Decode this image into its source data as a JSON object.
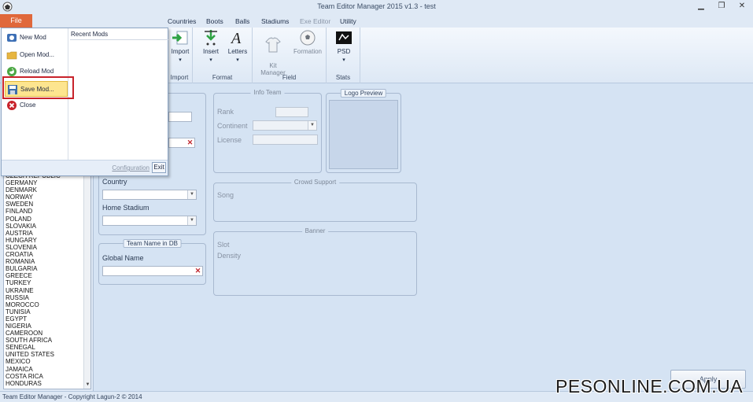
{
  "window": {
    "title": "Team Editor Manager 2015 v1.3 - test",
    "controls": {
      "minimize": "▁",
      "restore": "❐",
      "close": "✕"
    }
  },
  "menubar": {
    "file": "File",
    "items": [
      "Countries",
      "Boots",
      "Balls",
      "Stadiums",
      "Exe Editor",
      "Utility"
    ]
  },
  "ribbon": {
    "import": {
      "label": "Import",
      "group": "Import"
    },
    "insert": "Insert",
    "letters": "Letters",
    "format_group": "Format",
    "kit_manager": "Kit\nManager",
    "formation": "Formation",
    "field_group": "Field",
    "psd": "PSD",
    "stats_group": "Stats"
  },
  "file_menu": {
    "items": [
      {
        "label": "New Mod",
        "icon": "new-mod-icon"
      },
      {
        "label": "Open Mod...",
        "icon": "folder-icon"
      },
      {
        "label": "Reload Mod",
        "icon": "reload-icon"
      },
      {
        "label": "Save Mod...",
        "icon": "save-icon",
        "highlighted": true
      },
      {
        "label": "Close",
        "icon": "close-icon"
      }
    ],
    "recent_title": "Recent Mods",
    "configuration": "Configuration",
    "exit": "Exit"
  },
  "form": {
    "country_label": "Country",
    "home_stadium_label": "Home Stadium",
    "team_name_db_title": "Team Name in DB",
    "global_name_label": "Global Name",
    "info_team_title": "Info Team",
    "rank_label": "Rank",
    "continent_label": "Continent",
    "license_label": "License",
    "logo_preview_title": "Logo Preview",
    "crowd_support_title": "Crowd Support",
    "song_label": "Song",
    "banner_title": "Banner",
    "slot_label": "Slot",
    "density_label": "Density",
    "apply": "Apply"
  },
  "team_list": [
    "CZECH REPUBLIC",
    "GERMANY",
    "DENMARK",
    "NORWAY",
    "SWEDEN",
    "FINLAND",
    "POLAND",
    "SLOVAKIA",
    "AUSTRIA",
    "HUNGARY",
    "SLOVENIA",
    "CROATIA",
    "ROMANIA",
    "BULGARIA",
    "GREECE",
    "TURKEY",
    "UKRAINE",
    "RUSSIA",
    "MOROCCO",
    "TUNISIA",
    "EGYPT",
    "NIGERIA",
    "CAMEROON",
    "SOUTH AFRICA",
    "SENEGAL",
    "UNITED STATES",
    "MEXICO",
    "JAMAICA",
    "COSTA RICA",
    "HONDURAS"
  ],
  "statusbar": "Team Editor Manager - Copyright Lagun-2 © 2014",
  "watermark": "PESONLINE.COM.UA",
  "colors": {
    "file_tab": "#e0683b",
    "highlight": "#c8232b",
    "panel": "#d5e3f3"
  }
}
